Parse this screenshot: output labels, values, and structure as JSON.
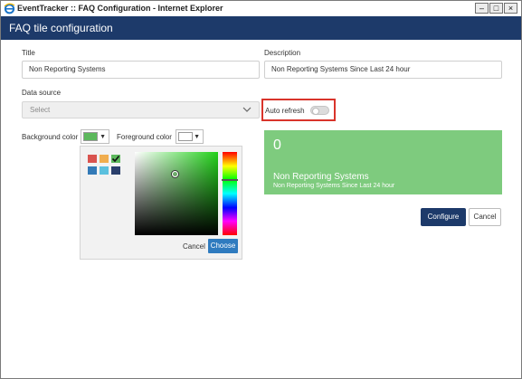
{
  "window": {
    "title": "EventTracker :: FAQ Configuration - Internet Explorer"
  },
  "header": {
    "title": "FAQ tile configuration"
  },
  "form": {
    "title_label": "Title",
    "title_value": "Non Reporting Systems",
    "description_label": "Description",
    "description_value": "Non Reporting Systems Since Last 24 hour",
    "datasource_label": "Data source",
    "datasource_placeholder": "Select",
    "auto_refresh_label": "Auto refresh",
    "auto_refresh_on": false,
    "bg_color_label": "Background color",
    "bg_color_value": "#5cb85c",
    "fg_color_label": "Foreground color",
    "fg_color_value": "#ffffff"
  },
  "picker": {
    "palette": [
      "#d9534f",
      "#f0ad4e",
      "#5cb85c",
      "#337ab7",
      "#5bc0de",
      "#2a3f6b"
    ],
    "selected_index": 2,
    "cancel_label": "Cancel",
    "choose_label": "Choose"
  },
  "preview": {
    "count": "0",
    "title": "Non Reporting Systems",
    "description": "Non Reporting Systems Since Last 24 hour",
    "bg_color": "#7ecb7e"
  },
  "actions": {
    "configure_label": "Configure",
    "cancel_label": "Cancel"
  }
}
